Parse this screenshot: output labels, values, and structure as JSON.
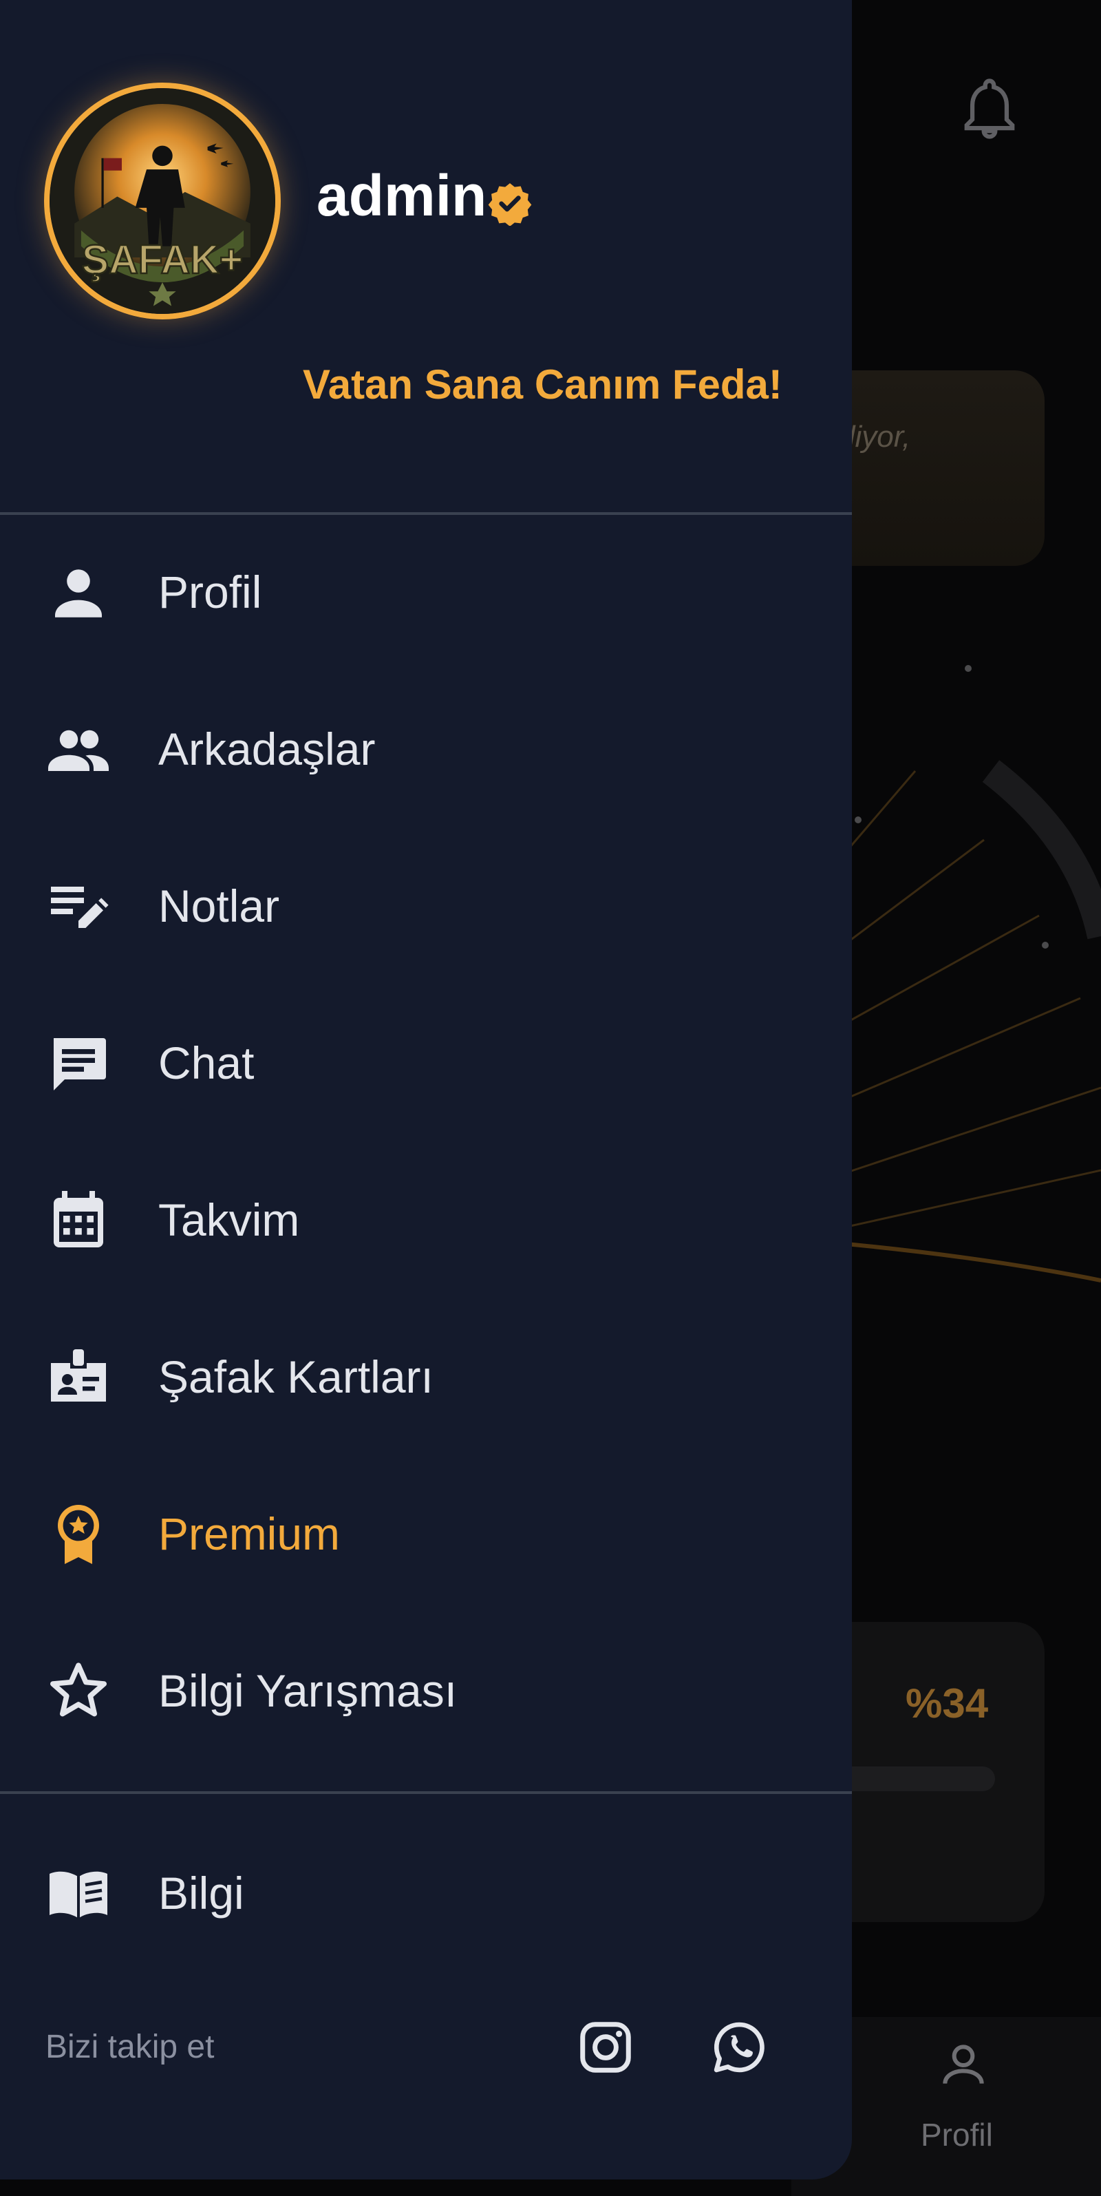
{
  "header": {
    "username": "admin",
    "motto": "Vatan Sana Canım Feda!",
    "logo_text": "ŞAFAK+"
  },
  "menu": {
    "items": [
      {
        "label": "Profil",
        "icon": "person-icon"
      },
      {
        "label": "Arkadaşlar",
        "icon": "people-icon"
      },
      {
        "label": "Notlar",
        "icon": "edit-note-icon"
      },
      {
        "label": "Chat",
        "icon": "chat-icon"
      },
      {
        "label": "Takvim",
        "icon": "calendar-icon"
      },
      {
        "label": "Şafak Kartları",
        "icon": "badge-card-icon"
      },
      {
        "label": "Premium",
        "icon": "premium-badge-icon",
        "highlighted": true
      },
      {
        "label": "Bilgi Yarışması",
        "icon": "star-outline-icon"
      }
    ],
    "secondary": [
      {
        "label": "Bilgi",
        "icon": "book-icon"
      }
    ]
  },
  "footer": {
    "follow_label": "Bizi takip et",
    "social": [
      "instagram-icon",
      "whatsapp-icon"
    ]
  },
  "background": {
    "quote_snippet": "diyor,",
    "progress_percent": "%34",
    "nav_profile_label": "Profil"
  },
  "colors": {
    "accent": "#f3aa3c",
    "drawer_bg": "#141a2c",
    "text": "#e4e6ec",
    "muted": "#8b90a0"
  }
}
